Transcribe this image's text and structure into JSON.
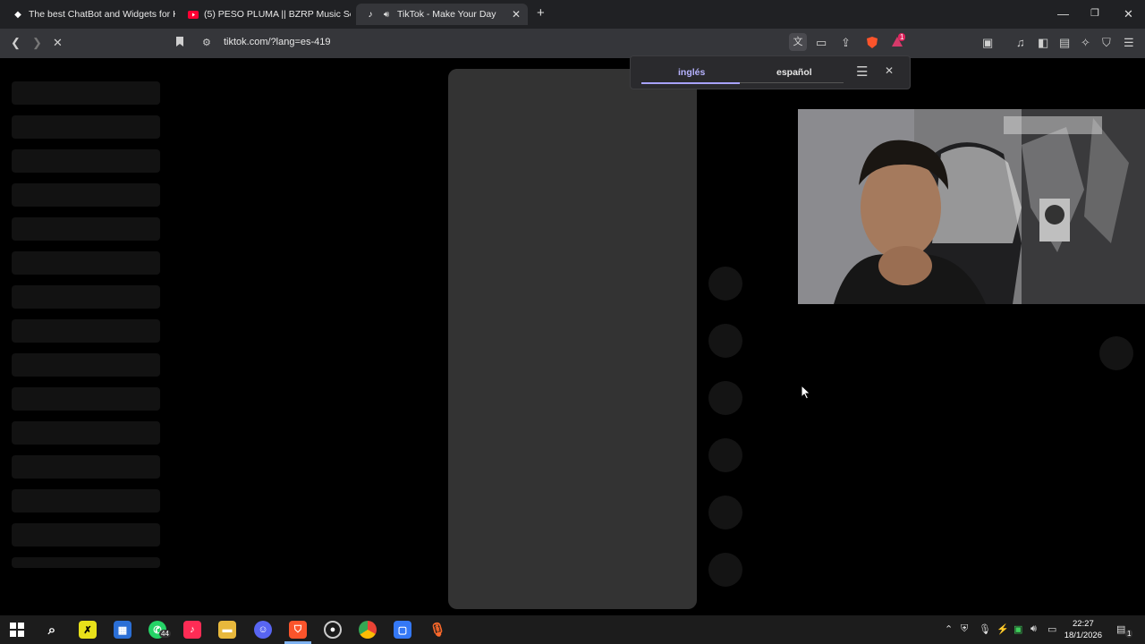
{
  "browser": {
    "tabs": [
      {
        "title": "The best ChatBot and Widgets for Ki",
        "icon": "chatbot-favicon"
      },
      {
        "title": "(5) PESO PLUMA || BZRP Music Sessio",
        "icon": "youtube-favicon"
      },
      {
        "title": "TikTok - Make Your Day",
        "icon": "tiktok-favicon",
        "active": true
      }
    ],
    "new_tab": "+",
    "url": "tiktok.com/?lang=es-419",
    "shield_badge": "1"
  },
  "translate": {
    "source_lang": "inglés",
    "target_lang": "español"
  },
  "taskbar": {
    "whatsapp_badge": "44",
    "time": "22:27",
    "date": "18/1/2026",
    "notification_count": "1"
  },
  "colors": {
    "page_bg": "#000000",
    "player_bg": "#333333",
    "accent": "#a8a2ff"
  }
}
